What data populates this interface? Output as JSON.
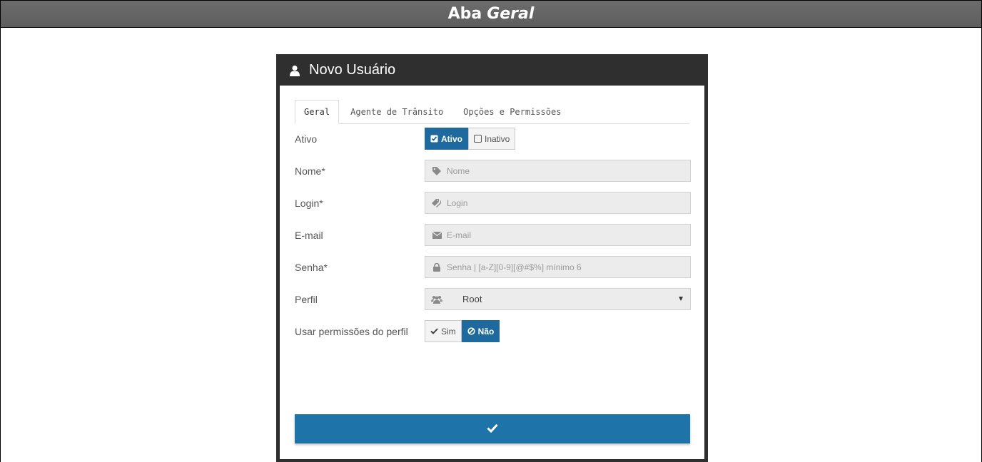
{
  "caption": {
    "prefix": "Aba",
    "emphasis": "Geral"
  },
  "modal": {
    "title": "Novo Usuário",
    "tabs": [
      {
        "label": "Geral",
        "active": true
      },
      {
        "label": "Agente de Trânsito",
        "active": false
      },
      {
        "label": "Opções e Permissões",
        "active": false
      }
    ],
    "fields": {
      "ativo": {
        "label": "Ativo",
        "options": [
          "Ativo",
          "Inativo"
        ],
        "selected": "Ativo"
      },
      "nome": {
        "label": "Nome*",
        "placeholder": "Nome",
        "icon": "tag-icon"
      },
      "login": {
        "label": "Login*",
        "placeholder": "Login",
        "icon": "tags-icon"
      },
      "email": {
        "label": "E-mail",
        "placeholder": "E-mail",
        "icon": "envelope-icon"
      },
      "senha": {
        "label": "Senha*",
        "placeholder": "Senha | [a-Z][0-9][@#$%] mínimo 6",
        "icon": "lock-icon"
      },
      "perfil": {
        "label": "Perfil",
        "value": "Root",
        "icon": "users-icon"
      },
      "usar_permissoes": {
        "label": "Usar permissões do perfil",
        "options": [
          "Sim",
          "Não"
        ],
        "selected": "Não"
      }
    },
    "submit": {
      "icon": "check-icon"
    }
  },
  "colors": {
    "accent": "#1e73a8",
    "modal_bg": "#2f2f2f",
    "caption_bg": "#666666"
  }
}
